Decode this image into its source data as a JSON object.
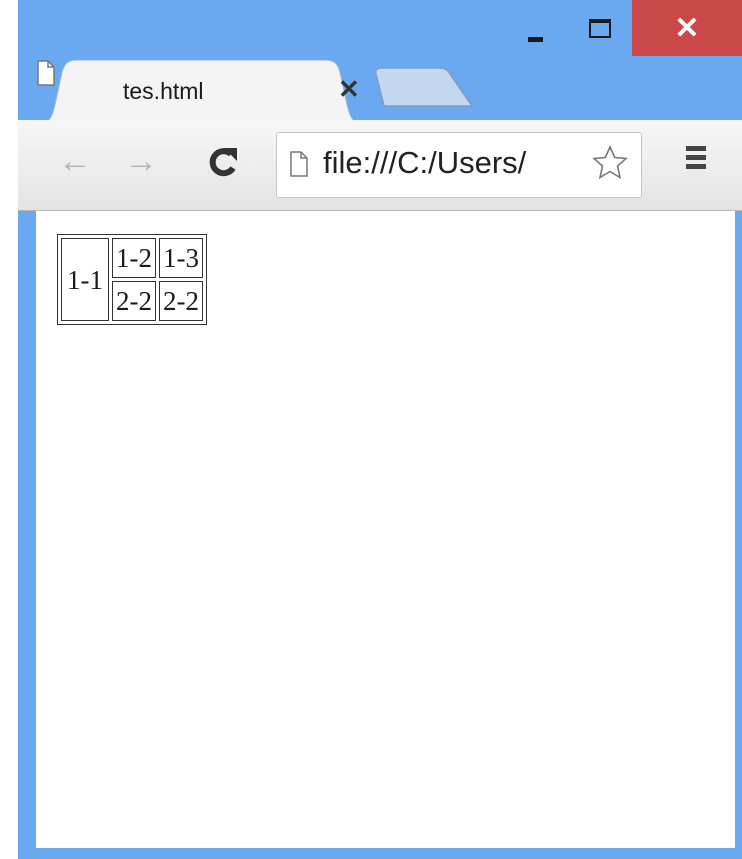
{
  "window": {
    "controls": {
      "close_glyph": "✕",
      "minimize_icon": "minimize-icon",
      "maximize_icon": "maximize-icon"
    }
  },
  "tabs": [
    {
      "title": "tes.html",
      "close_glyph": "✕",
      "icon": "file-icon"
    }
  ],
  "toolbar": {
    "back_glyph": "←",
    "forward_glyph": "→",
    "reload_icon": "reload-icon",
    "address": "file:///C:/Users/",
    "star_icon": "star-icon",
    "menu_icon": "menu-icon"
  },
  "table": {
    "cells": {
      "c11": "1-1",
      "c12": "1-2",
      "c13": "1-3",
      "c22a": "2-2",
      "c22b": "2-2"
    }
  }
}
